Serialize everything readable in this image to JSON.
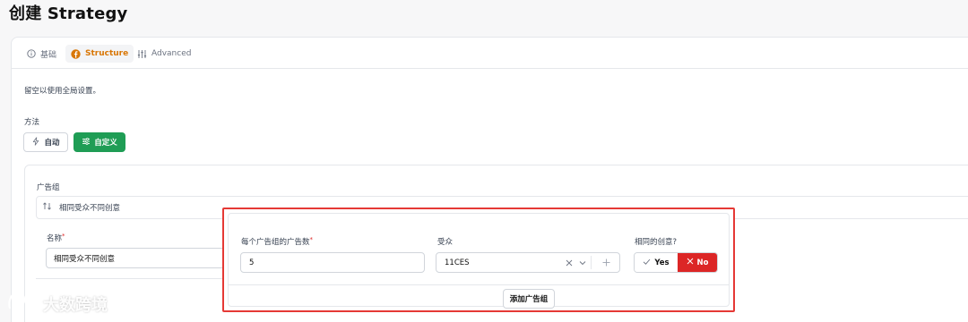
{
  "page": {
    "title": "创建 Strategy"
  },
  "tabs": [
    {
      "label": "基础",
      "icon": "info-icon",
      "active": false
    },
    {
      "label": "Structure",
      "icon": "facebook-icon",
      "active": true
    },
    {
      "label": "Advanced",
      "icon": "sliders-icon",
      "active": false
    }
  ],
  "hint": "留空以使用全局设置。",
  "method": {
    "label": "方法",
    "auto_label": "自动",
    "custom_label": "自定义",
    "selected": "自定义"
  },
  "adgroup": {
    "label": "广告组",
    "accordion_title": "相同受众不同创意",
    "name_label": "名称",
    "name_value": "相同受众不同创意",
    "ads_per_group_label": "每个广告组的广告数",
    "ads_per_group_value": "5",
    "audience_label": "受众",
    "audience_value": "11CES",
    "same_creative_label": "相同的创意?",
    "yes_label": "Yes",
    "no_label": "No",
    "selected_same_creative": "No",
    "add_button_label": "添加广告组"
  },
  "watermark": {
    "text": "大数跨境"
  },
  "colors": {
    "accent_green": "#1f9d55",
    "accent_orange": "#d97706",
    "no_red": "#dc2626",
    "highlight_border": "#e53935"
  }
}
